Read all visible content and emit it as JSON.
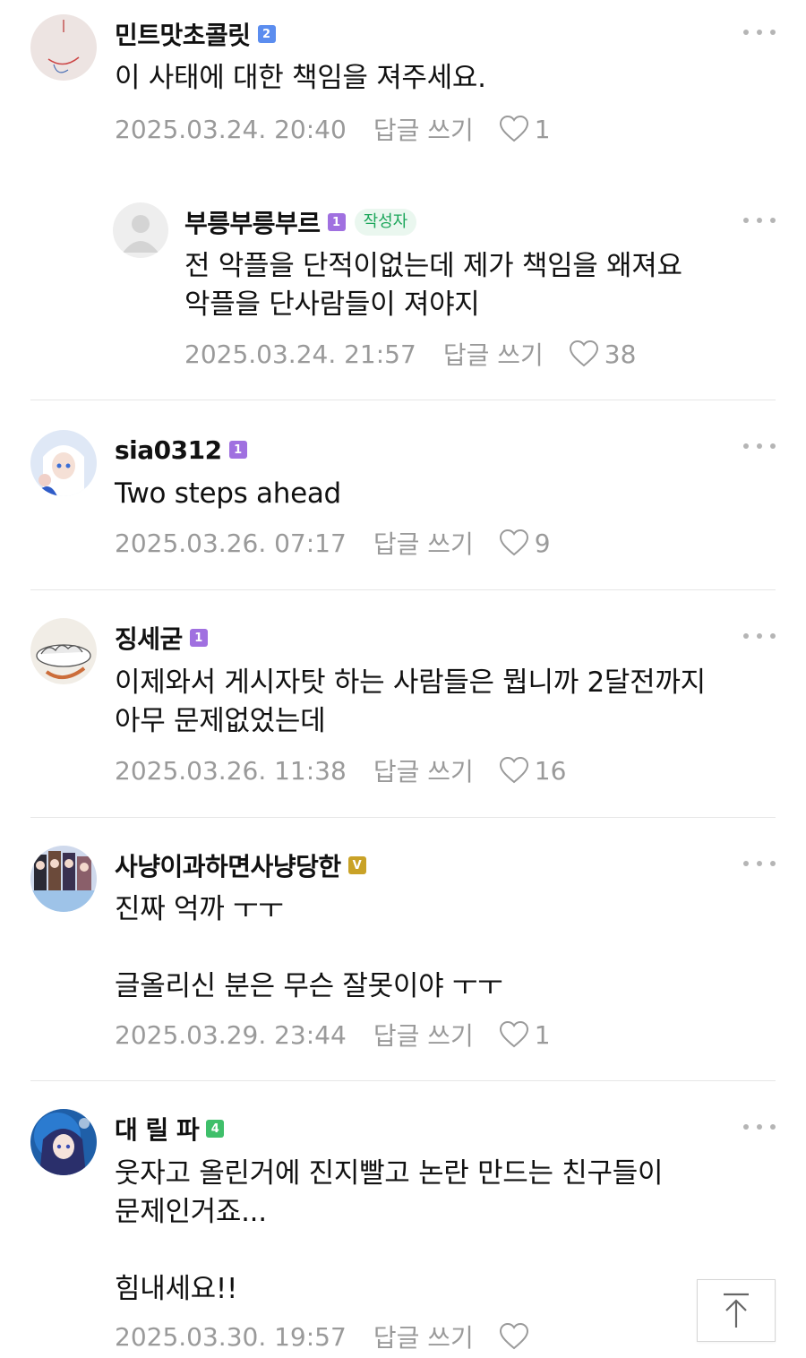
{
  "comments": [
    {
      "nickname": "민트맛초콜릿",
      "badge": "2",
      "text": "이 사태에 대한 책임을 져주세요.",
      "date": "2025.03.24. 20:40",
      "reply_label": "답글 쓰기",
      "likes": "1"
    },
    {
      "nickname": "부릉부릉부르",
      "badge": "1",
      "author_tag": "작성자",
      "text": "전 악플을 단적이없는데 제가 책임을 왜져요\n악플을 단사람들이 져야지",
      "date": "2025.03.24. 21:57",
      "reply_label": "답글 쓰기",
      "likes": "38"
    },
    {
      "nickname": "sia0312",
      "badge": "1",
      "text": "Two steps ahead",
      "date": "2025.03.26. 07:17",
      "reply_label": "답글 쓰기",
      "likes": "9"
    },
    {
      "nickname": "징세굳",
      "badge": "1",
      "text": "이제와서 게시자탓 하는 사람들은 뭡니까 2달전까지\n아무 문제없었는데",
      "date": "2025.03.26. 11:38",
      "reply_label": "답글 쓰기",
      "likes": "16"
    },
    {
      "nickname": "사냥이과하면사냥당한",
      "badge": "V",
      "text": "진짜 억까 ㅜㅜ\n\n글올리신 분은 무슨 잘못이야 ㅜㅜ",
      "date": "2025.03.29. 23:44",
      "reply_label": "답글 쓰기",
      "likes": "1"
    },
    {
      "nickname": "대 릴 파",
      "badge": "4",
      "text": "웃자고 올린거에 진지빨고 논란 만드는 친구들이\n문제인거죠...\n\n힘내세요!!",
      "date": "2025.03.30. 19:57",
      "reply_label": "답글 쓰기",
      "likes": ""
    }
  ],
  "colors": {
    "badge_blue": "#5b8def",
    "badge_purple": "#a070e0",
    "badge_gold": "#c9a227",
    "badge_green": "#3fbf6a",
    "meta_gray": "#9a9a9a",
    "author_green": "#1ba65a"
  },
  "icons": {
    "more": "more-dots-icon",
    "like": "heart-outline-icon",
    "scroll_top": "arrow-up-icon"
  }
}
